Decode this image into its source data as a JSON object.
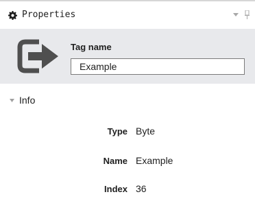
{
  "panel": {
    "title": "Properties",
    "icons": {
      "title_icon": "gear-icon",
      "menu_icon": "dropdown-arrow-icon",
      "pin_icon": "pin-icon"
    }
  },
  "header": {
    "icon": "tag-exit-icon",
    "tag_label": "Tag name",
    "tag_value": "Example"
  },
  "info": {
    "group_label": "Info",
    "properties": [
      {
        "name": "Type",
        "value": "Byte"
      },
      {
        "name": "Name",
        "value": "Example"
      },
      {
        "name": "Index",
        "value": "36"
      }
    ]
  },
  "colors": {
    "header_background": "#e8e9ec",
    "icon_gray": "#4f4f4f",
    "text": "#1e1e1e"
  }
}
